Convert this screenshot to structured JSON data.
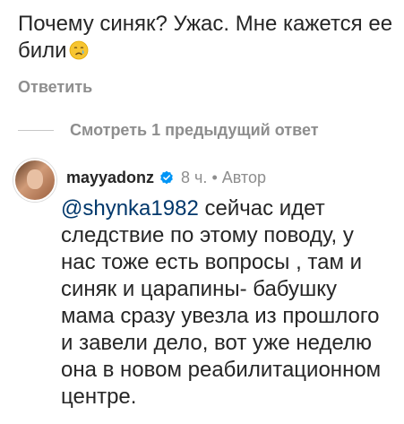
{
  "parent_comment": {
    "text": "Почему синяк? Ужас. Мне кажется ее били",
    "emoji": "crying-face",
    "reply_label": "Ответить"
  },
  "thread": {
    "view_previous_label": "Смотреть 1 предыдущий ответ"
  },
  "reply": {
    "username": "mayyadonz",
    "verified": true,
    "time": "8 ч.",
    "separator": "•",
    "author_label": "Автор",
    "mention": "@shynka1982",
    "text": " сейчас идет следствие по этому поводу, у нас тоже есть вопросы , там и синяк и царапины- бабушку мама сразу увезла из прошлого и завели дело, вот уже неделю она в новом реабилитационном центре."
  },
  "colors": {
    "text": "#262626",
    "secondary": "#8e8e8e",
    "mention": "#00376b",
    "verified": "#0095f6"
  }
}
